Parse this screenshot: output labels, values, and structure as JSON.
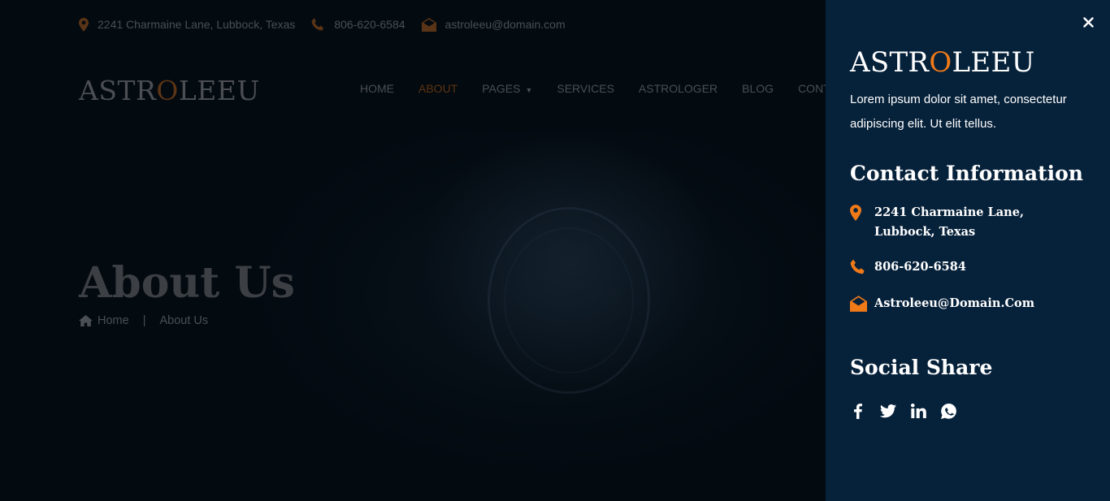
{
  "topbar": {
    "address": "2241 Charmaine Lane, Lubbock, Texas",
    "phone": "806-620-6584",
    "email": "astroleeu@domain.com"
  },
  "logo": {
    "prefix": "ASTR",
    "o": "O",
    "suffix": "LEEU"
  },
  "nav": {
    "items": [
      {
        "label": "HOME"
      },
      {
        "label": "ABOUT",
        "active": true
      },
      {
        "label": "PAGES"
      },
      {
        "label": "SERVICES"
      },
      {
        "label": "ASTROLOGER"
      },
      {
        "label": "BLOG"
      },
      {
        "label": "CONTA"
      }
    ]
  },
  "hero": {
    "title": "About Us",
    "breadcrumb": {
      "home": "Home",
      "separator": "|",
      "current": "About Us"
    }
  },
  "panel": {
    "description": "Lorem ipsum dolor sit amet, consectetur adipiscing elit. Ut elit tellus.",
    "contact_heading": "Contact Information",
    "contact": {
      "address": "2241 Charmaine Lane, Lubbock, Texas",
      "phone": "806-620-6584",
      "email": "Astroleeu@Domain.Com"
    },
    "social_heading": "Social Share",
    "social_icons": [
      "facebook-icon",
      "twitter-icon",
      "linkedin-icon",
      "whatsapp-icon"
    ],
    "close_icon": "close-icon"
  },
  "colors": {
    "accent": "#f07a18",
    "panel_bg": "#06213a",
    "page_bg": "#030a10"
  }
}
